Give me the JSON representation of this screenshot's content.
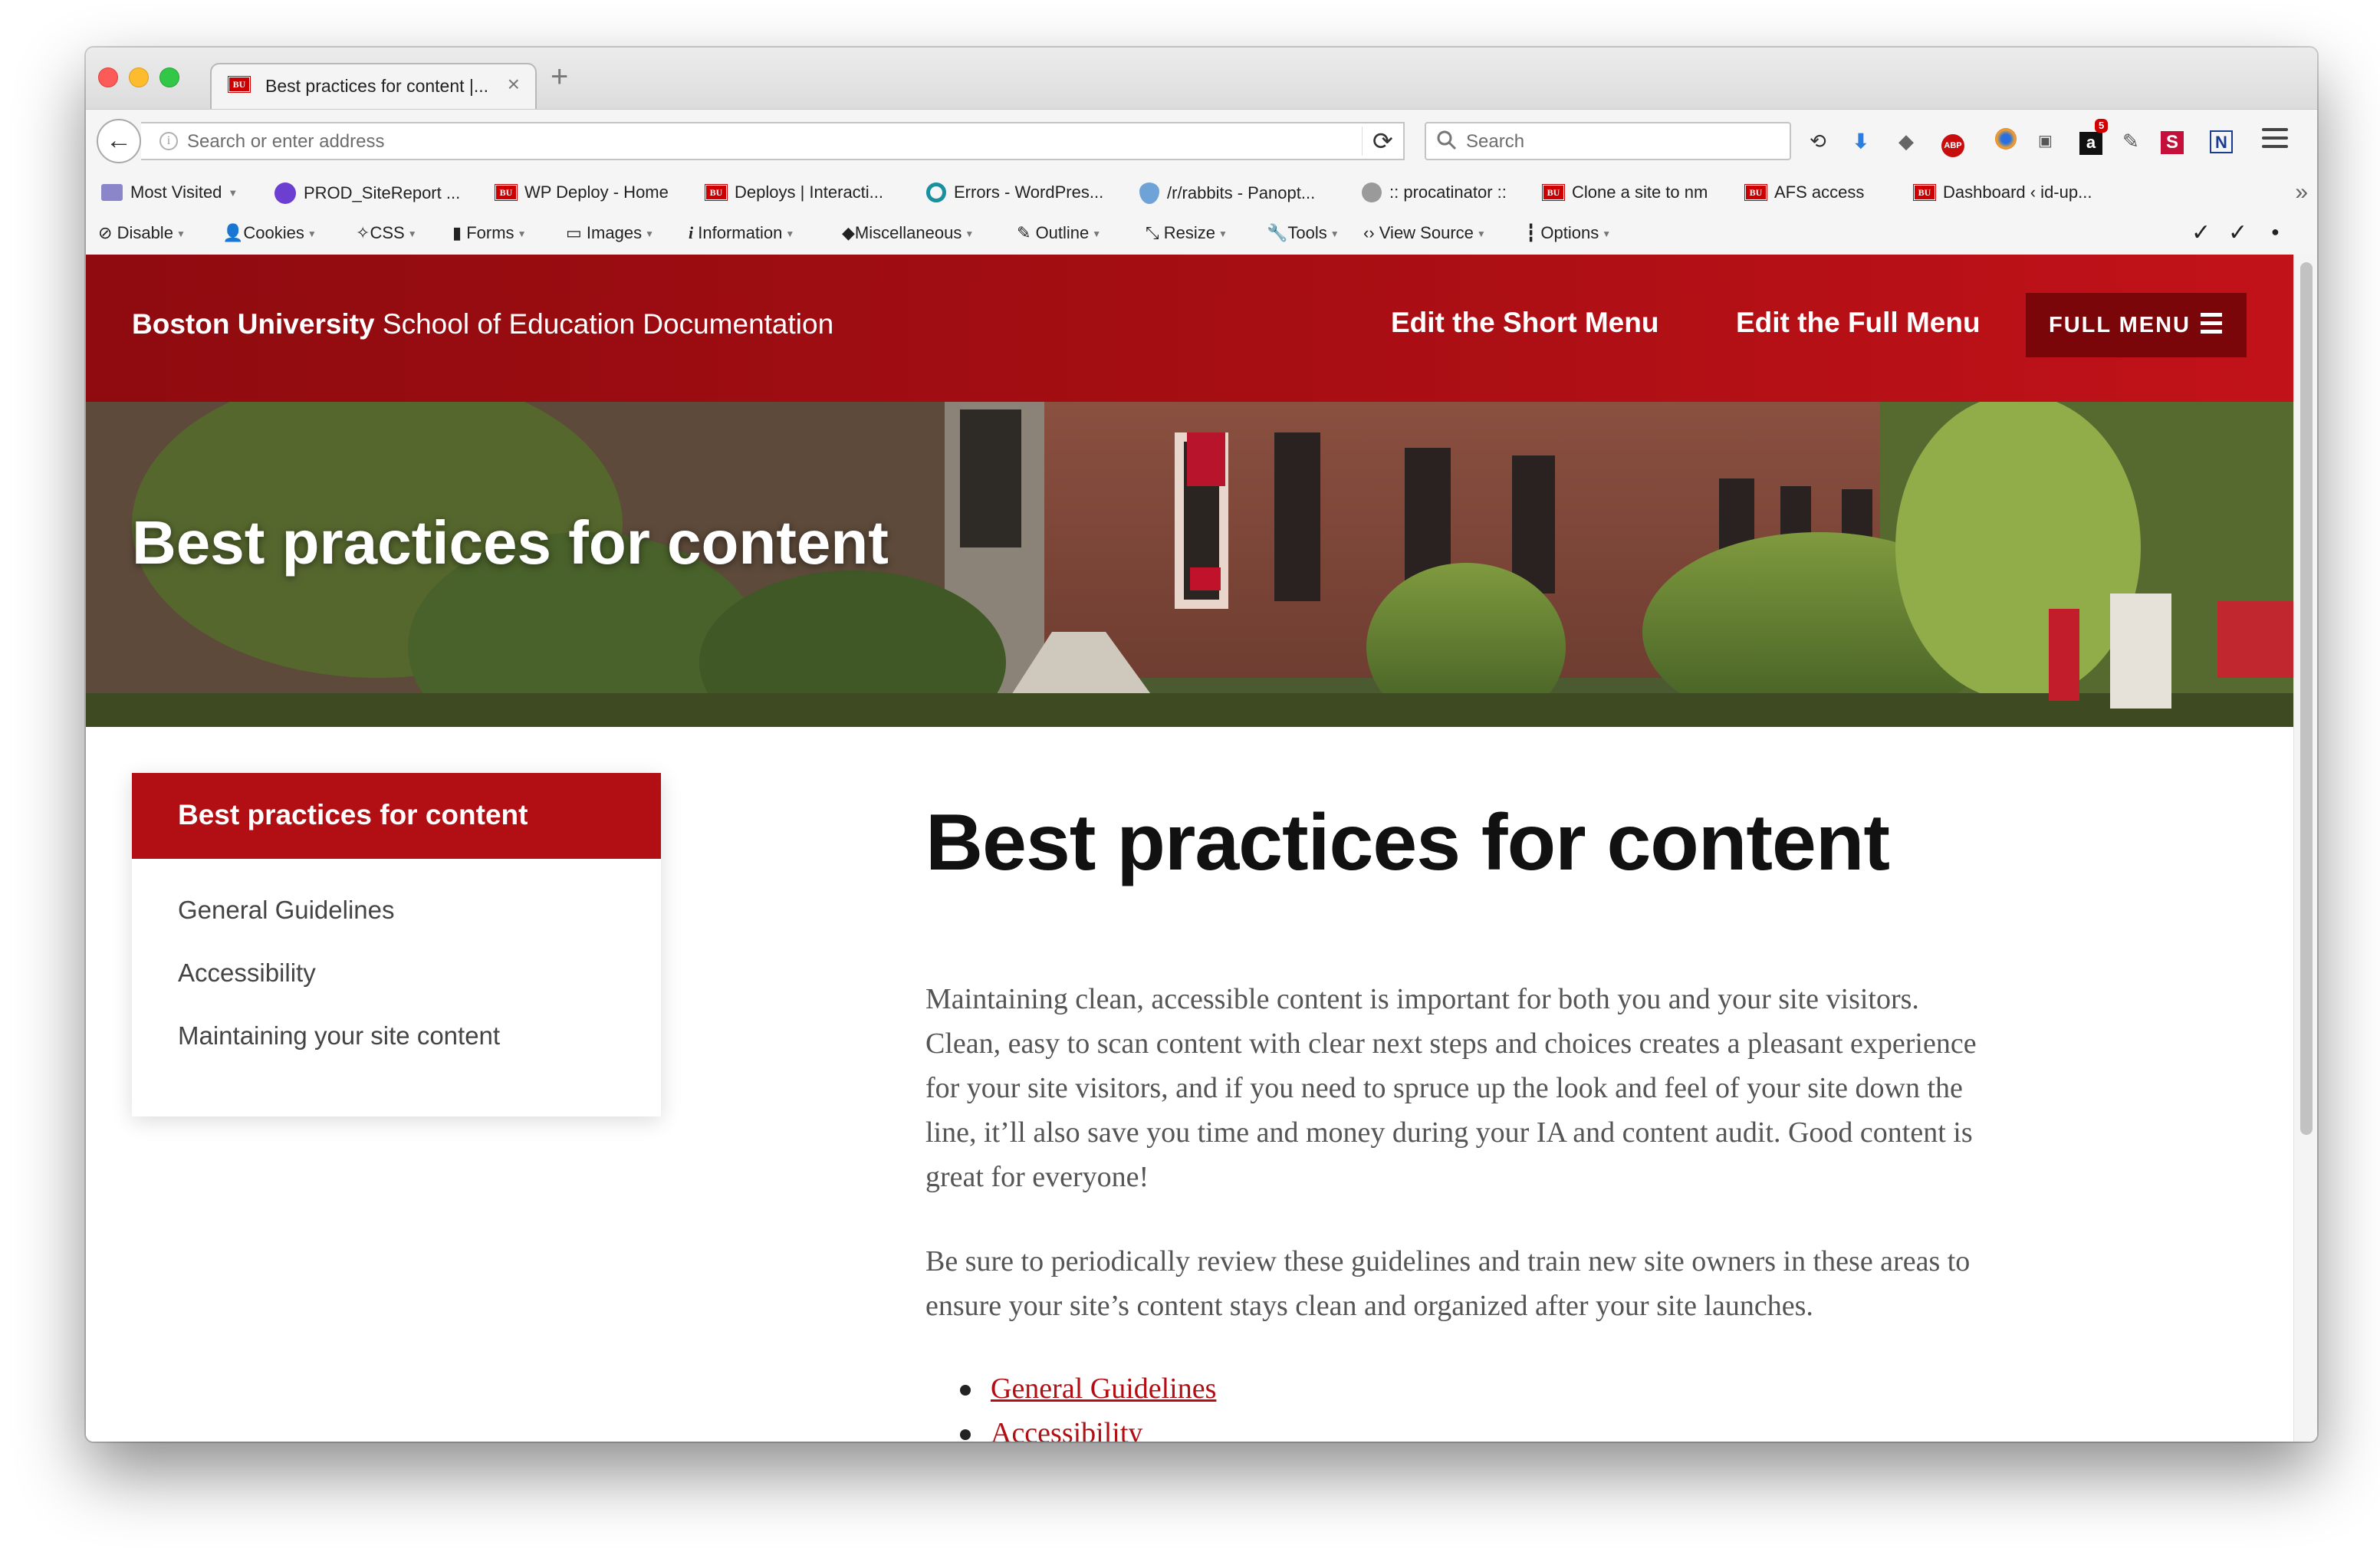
{
  "browser": {
    "tab": {
      "title": "Best practices for content |...",
      "favicon": "BU"
    },
    "address": {
      "placeholder": "Search or enter address"
    },
    "search": {
      "placeholder": "Search"
    },
    "extension_badge": "5",
    "bookmarks": [
      {
        "label": "Most Visited",
        "icon": "bookmark-folder-icon"
      },
      {
        "label": "PROD_SiteReport ...",
        "icon": "shield-icon"
      },
      {
        "label": "WP Deploy - Home",
        "icon": "BU"
      },
      {
        "label": "Deploys | Interacti...",
        "icon": "BU"
      },
      {
        "label": "Errors - WordPres...",
        "icon": "circle-icon"
      },
      {
        "label": "/r/rabbits - Panopt...",
        "icon": "shield-icon"
      },
      {
        "label": ":: procatinator ::",
        "icon": "globe-icon"
      },
      {
        "label": "Clone a site to nm",
        "icon": "BU"
      },
      {
        "label": "AFS access",
        "icon": "BU"
      },
      {
        "label": "Dashboard ‹ id-up...",
        "icon": "BU"
      }
    ],
    "devtools": [
      "Disable",
      "Cookies",
      "CSS",
      "Forms",
      "Images",
      "Information",
      "Miscellaneous",
      "Outline",
      "Resize",
      "Tools",
      "View Source",
      "Options"
    ]
  },
  "site": {
    "brand_bold": "Boston University",
    "brand_rest": " School of Education Documentation",
    "links": [
      "Edit the Short Menu",
      "Edit the Full Menu"
    ],
    "menu_button": "FULL MENU",
    "hero_title": "Best practices for content",
    "sidebar": {
      "title": "Best practices for content",
      "items": [
        "General Guidelines",
        "Accessibility",
        "Maintaining your site content"
      ]
    },
    "main": {
      "heading": "Best practices for content",
      "paragraphs": [
        "Maintaining clean, accessible content is important for both you and your site visitors. Clean, easy to scan content with clear next steps and choices creates a pleasant experience for your site visitors, and if you need to spruce up the look and feel of your site down the line, it’ll also save you time and money during your IA and content audit. Good content is great for everyone!",
        "Be sure to periodically review these guidelines and train new site owners in these areas to ensure your site’s content stays clean and organized after your site launches."
      ],
      "links": [
        "General Guidelines",
        "Accessibility"
      ]
    }
  },
  "colors": {
    "brand_red": "#b20f14",
    "header_dark_red": "#8f0b0f",
    "menu_button": "#7a0609"
  }
}
